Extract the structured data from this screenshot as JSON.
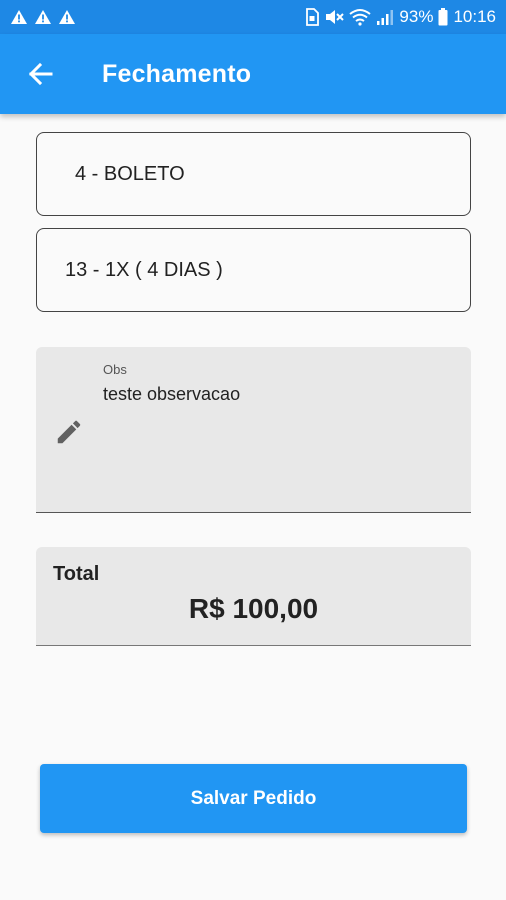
{
  "status_bar": {
    "battery": "93%",
    "time": "10:16",
    "icons": [
      "warning-icon",
      "warning-icon",
      "warning-icon",
      "sim-icon",
      "mute-icon",
      "wifi-icon",
      "signal-icon",
      "battery-icon"
    ]
  },
  "app_bar": {
    "title": "Fechamento",
    "back_icon": "arrow-left-icon"
  },
  "form": {
    "payment_method": "4 - BOLETO",
    "payment_terms": "13 - 1X ( 4 DIAS )",
    "obs": {
      "label": "Obs",
      "value": "teste observacao",
      "icon": "pencil-icon"
    }
  },
  "total": {
    "label": "Total",
    "value": "R$ 100,00"
  },
  "actions": {
    "save_label": "Salvar Pedido"
  },
  "colors": {
    "primary": "#2196f3",
    "status_bar": "#1e88e5",
    "background": "#fafafa",
    "field_fill": "#e8e8e8"
  }
}
